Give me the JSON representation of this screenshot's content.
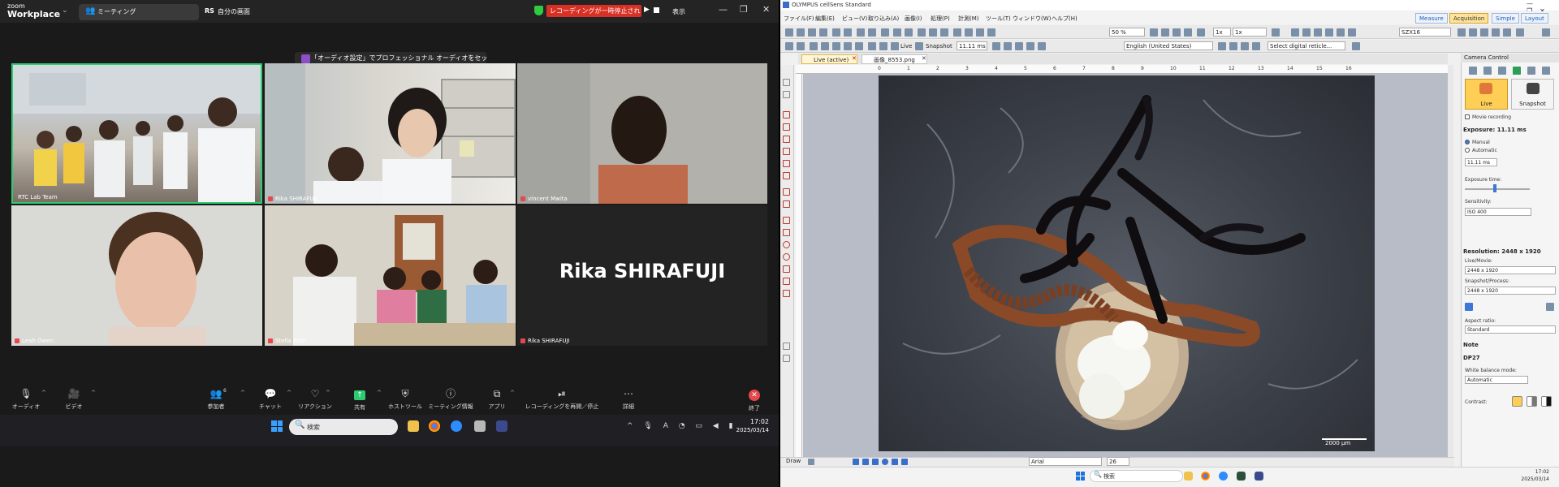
{
  "zoom": {
    "logo_line1": "zoom",
    "logo_line2": "Workplace",
    "meeting_label": "ミーティング",
    "my_screen_badge": "RS",
    "my_screen_label": "自分の画面",
    "recording_banner": "レコーディングが一時停止されました",
    "view_label": "表示",
    "audio_banner": "「オーディオ設定」でプロフェッショナル オーディオをセットアップする",
    "tiles": [
      {
        "name": "RTC Lab Team"
      },
      {
        "name": "Rika SHIRAFUJI"
      },
      {
        "name": "vincent Mwita"
      },
      {
        "name": "Leah Owen"
      },
      {
        "name": "Stella Atim"
      },
      {
        "name": "Rika SHIRAFUJI"
      }
    ],
    "big_name": "Rika SHIRAFUJI",
    "toolbar": {
      "audio": "オーディオ",
      "video": "ビデオ",
      "participants": "参加者",
      "participants_count": "6",
      "chat": "チャット",
      "reactions": "リアクション",
      "share": "共有",
      "host_tools": "ホストツール",
      "meeting_info": "ミーティング情報",
      "apps": "アプリ",
      "recording": "レコーディングを再開／停止",
      "more": "詳細",
      "end": "終了"
    },
    "taskbar": {
      "search": "検索",
      "time": "17:02",
      "date": "2025/03/14"
    }
  },
  "olympus": {
    "title": "OLYMPUS cellSens Standard",
    "menus": [
      "ファイル(F)",
      "編集(E)",
      "ビュー(V)",
      "取り込み(A)",
      "画像(I)",
      "処理(P)",
      "計測(M)",
      "ツール(T)",
      "ウィンドウ(W)",
      "ヘルプ(H)"
    ],
    "layouts": [
      "Measure",
      "Acquisition",
      "Simple",
      "Layout"
    ],
    "toolbar": {
      "zoom_value": "50 %",
      "magnification": "1x",
      "magnification2": "1x",
      "objective": "SZX16",
      "live_label": "Live",
      "snapshot_label": "Snapshot",
      "exposure_field": "11.11 ms",
      "language": "English (United States)",
      "reticle": "Select digital reticle..."
    },
    "doc_tabs": [
      "Live (active)",
      "画像_8553.png"
    ],
    "ruler": [
      "0",
      "1",
      "2",
      "3",
      "4",
      "5",
      "6",
      "7",
      "8",
      "9",
      "10",
      "11",
      "12",
      "13",
      "14",
      "15",
      "16"
    ],
    "scalebar": "2000 µm",
    "draw_label": "Draw",
    "font": "Arial",
    "font_size": "26",
    "camera": {
      "title": "Camera Control",
      "live": "Live",
      "snapshot": "Snapshot",
      "movie_recording": "Movie recording",
      "exposure_header": "Exposure: 11.11 ms",
      "manual": "Manual",
      "automatic": "Automatic",
      "exposure_value": "11.11 ms",
      "exposure_time": "Exposure time:",
      "sensitivity": "Sensitivity:",
      "sensitivity_value": "ISO 400",
      "resolution_header": "Resolution: 2448 x 1920",
      "live_movie": "Live/Movie:",
      "live_movie_value": "2448 x 1920",
      "snapshot_process": "Snapshot/Process:",
      "snapshot_process_value": "2448 x 1920",
      "aspect_ratio": "Aspect ratio:",
      "aspect_ratio_value": "Standard",
      "note": "Note",
      "camera_model": "DP27",
      "white_balance": "White balance mode:",
      "white_balance_value": "Automatic",
      "contrast": "Contrast:"
    },
    "taskbar": {
      "search": "検索",
      "time": "17:02",
      "date": "2025/03/14"
    }
  }
}
